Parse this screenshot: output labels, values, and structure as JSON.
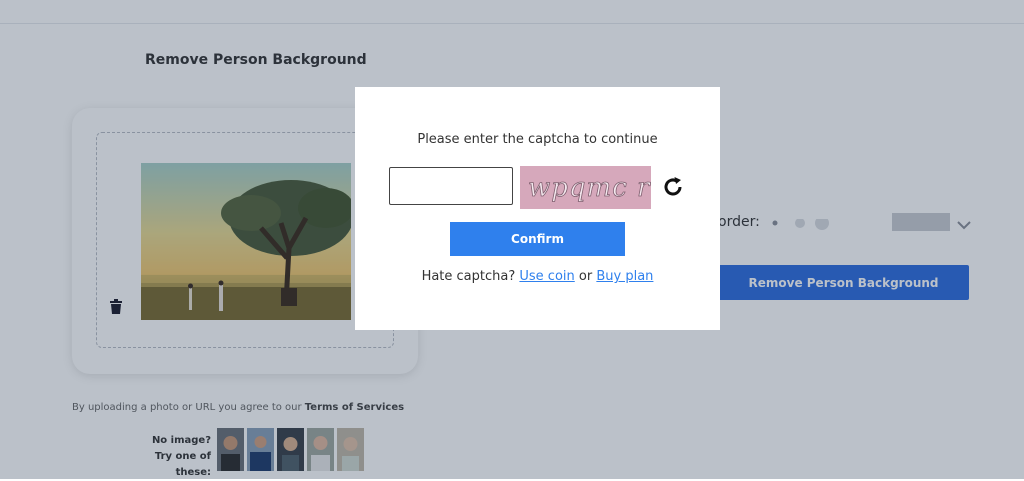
{
  "page": {
    "title": "Remove Person Background",
    "terms_prefix": "By uploading a photo or URL you agree to our",
    "terms_link": "Terms of Services",
    "samples_label_line1": "No image?",
    "samples_label_line2": "Try one of these:",
    "border_label": "order:",
    "remove_button": "Remove Person Background"
  },
  "modal": {
    "prompt": "Please enter the captcha to continue",
    "captcha_text": "wpqmc r",
    "input_value": "",
    "confirm_label": "Confirm",
    "hate_text": "Hate captcha?",
    "use_coin": "Use coin",
    "or_text": "or",
    "buy_plan": "Buy plan"
  },
  "colors": {
    "primary": "#2f80ed",
    "remove_button": "#2d6cdf",
    "captcha_bg": "#d6a8bb"
  }
}
